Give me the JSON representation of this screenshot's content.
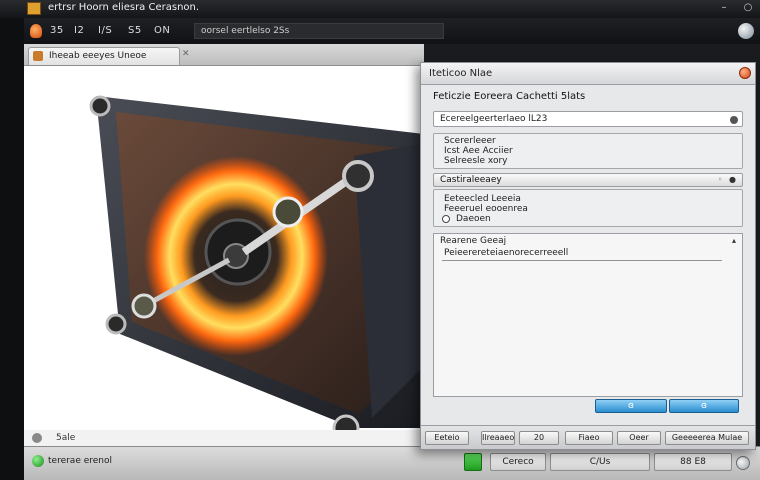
{
  "window": {
    "title": "ertrsr Hoorn eliesra Cerasnon.",
    "controls": [
      "–",
      "○"
    ]
  },
  "menu": {
    "items": [
      "35",
      "I2",
      "I/S",
      "S5",
      "ON"
    ],
    "search_text": "oorsel eertlelso 2Ss"
  },
  "tab": {
    "label": "Iheeab eeeyes Uneoe"
  },
  "left_status": {
    "label": "5ale"
  },
  "bottom": {
    "status_text": "tererae erenol",
    "buttons": [
      "Cereco",
      "C/Us",
      "88 E8"
    ]
  },
  "dialog": {
    "title": "Iteticoo Nlae",
    "heading": "Feticzie Eoreera Cachetti 5lats",
    "field1": "Ecereelgeerterlaeo lL23",
    "group1": {
      "lines": [
        "Scererleeer",
        "Icst Aee Acciier",
        "Selreesle xory"
      ]
    },
    "combo": {
      "text": "Castiraleeaey",
      "arrows": "◦ ●"
    },
    "group2": {
      "lines": [
        "Eeteecled Leeeia",
        "Feeeruel eooenrea",
        "Daeoen"
      ]
    },
    "listbox": {
      "header": "Rearene Geeaj",
      "item": "Peieerereteiaenorecerreeell"
    },
    "blue_buttons": [
      "ɞ",
      "ɞ"
    ],
    "footer_buttons": [
      "Eeteio",
      "Ilreaaeo",
      "20",
      "Fiaeo",
      "Oeer",
      "Geeeeerea Mulae"
    ]
  }
}
